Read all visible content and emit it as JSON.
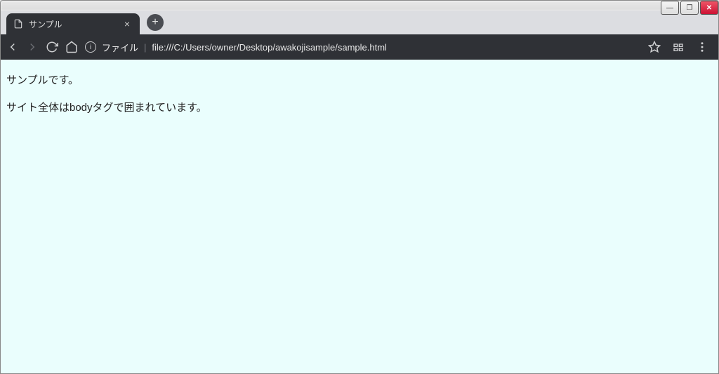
{
  "windowControls": {
    "minimize": "—",
    "maximize": "❐",
    "close": "✕"
  },
  "tab": {
    "title": "サンプル"
  },
  "addressbar": {
    "schemeLabel": "ファイル",
    "url": "file:///C:/Users/owner/Desktop/awakojisample/sample.html"
  },
  "content": {
    "p1": "サンプルです。",
    "p2": "サイト全体はbodyタグで囲まれています。"
  }
}
